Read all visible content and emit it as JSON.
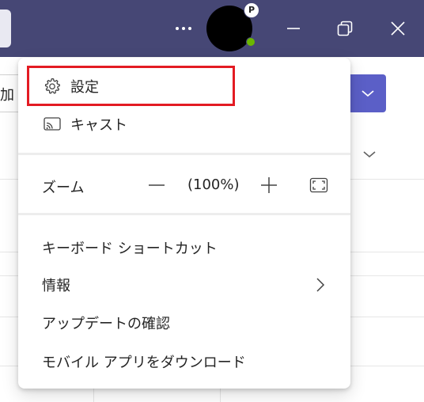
{
  "menu": {
    "settings": {
      "label": "設定",
      "icon": "gear-icon"
    },
    "cast": {
      "label": "キャスト",
      "icon": "cast-icon"
    },
    "zoom": {
      "label": "ズーム",
      "value": "(100%)"
    },
    "shortcuts": {
      "label": "キーボード ショートカット"
    },
    "about": {
      "label": "情報",
      "icon": "chevron-right-icon"
    },
    "update": {
      "label": "アップデートの確認"
    },
    "mobile": {
      "label": "モバイル アプリをダウンロード"
    }
  },
  "titlebar": {
    "presence_badge": "P"
  },
  "background": {
    "left_button_fragment": "加"
  },
  "colors": {
    "titlebar": "#464775",
    "accent": "#5b5fc7",
    "highlight_border": "#e31b23",
    "presence_available": "#6bb700"
  }
}
